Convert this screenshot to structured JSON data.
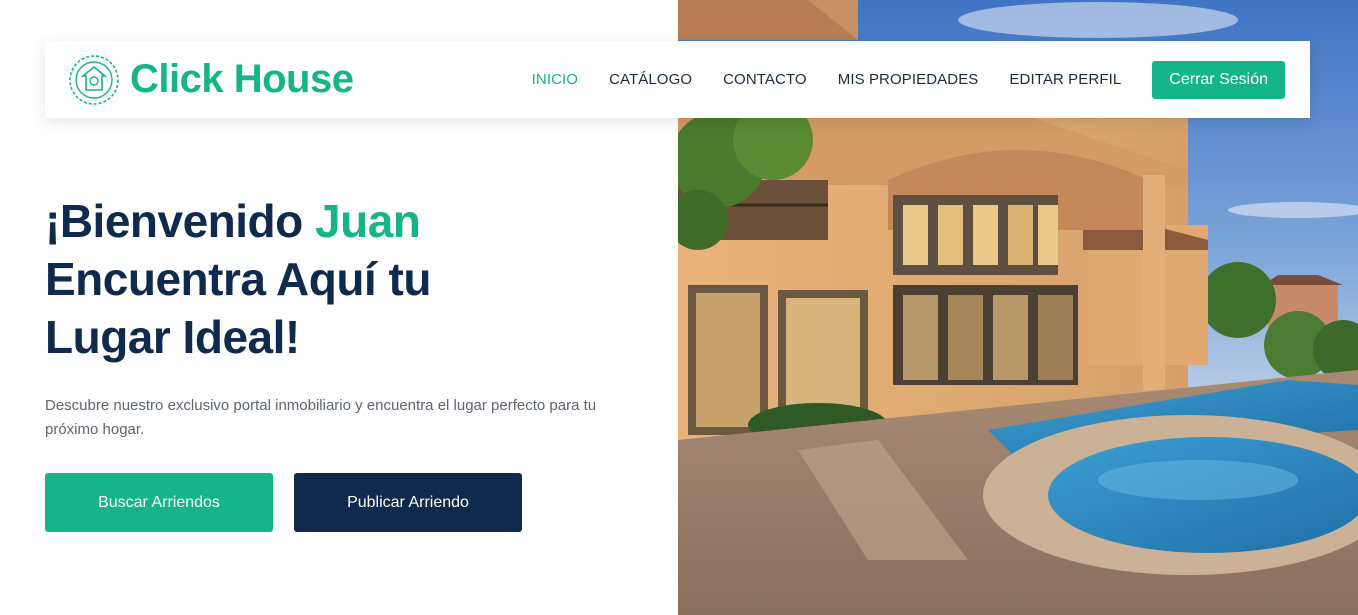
{
  "brand": {
    "name": "Click House",
    "logo_icon": "house-emblem-icon",
    "color": "#16b489"
  },
  "nav": {
    "items": [
      {
        "label": "INICIO",
        "active": true
      },
      {
        "label": "CATÁLOGO",
        "active": false
      },
      {
        "label": "CONTACTO",
        "active": false
      },
      {
        "label": "MIS PROPIEDADES",
        "active": false
      },
      {
        "label": "EDITAR PERFIL",
        "active": false
      }
    ],
    "logout_label": "Cerrar Sesión"
  },
  "hero": {
    "greeting": "¡Bienvenido",
    "user_name": "Juan",
    "title_line2": "Encuentra Aquí tu",
    "title_line3": "Lugar Ideal!",
    "description": "Descubre nuestro exclusivo portal inmobiliario y encuentra el lugar perfecto para tu próximo hogar.",
    "primary_button": "Buscar Arriendos",
    "secondary_button": "Publicar Arriendo"
  },
  "colors": {
    "accent": "#16b489",
    "navy": "#0f2a4c",
    "text_muted": "#5d6673"
  }
}
